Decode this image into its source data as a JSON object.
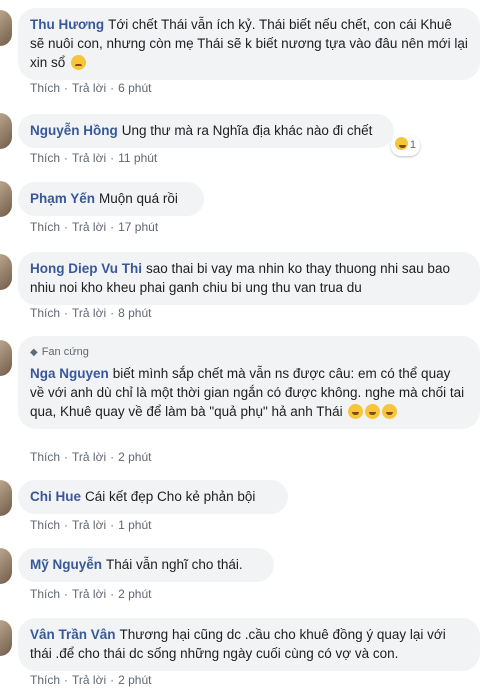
{
  "labels": {
    "like": "Thích",
    "reply": "Trả lời",
    "dot": "·"
  },
  "comments": [
    {
      "name": "Thu Hương",
      "text": "Tới chết Thái vẫn ích kỷ. Thái biết nếu chết, con cái Khuê sẽ nuôi con, nhưng còn mẹ Thái sẽ k biết nương tựa vào đâu nên mới lại xin sổ",
      "emoji": "sad-face",
      "time": "6 phút"
    },
    {
      "name": "Nguyễn Hồng",
      "text": "Ung thư mà ra Nghĩa địa khác nào đi chết",
      "reaction": {
        "icon": "laughing-face",
        "count": "1"
      },
      "time": "11 phút"
    },
    {
      "name": "Phạm Yến",
      "text": "Muộn quá rồi",
      "time": "17 phút"
    },
    {
      "name": "Hong Diep Vu Thi",
      "text": "sao thai bi vay ma nhin ko thay thuong nhi sau bao nhiu noi kho kheu phai ganh chiu bi ung thu van trua du",
      "time": "8 phút"
    },
    {
      "badge": "Fan cứng",
      "badge_icon": "diamond-icon",
      "name": "Nga Nguyen",
      "text": "biết mình sắp chết mà vẫn ns được câu: em có thể quay về với anh dù chỉ là một thời gian ngắn có được không. nghe mà chối tai qua, Khuê quay về để làm bà \"quả phụ\" hả anh Thái",
      "emoji": "laughing-face x3",
      "time": "2 phút"
    },
    {
      "name": "Chi Hue",
      "text": "Cái kết đẹp Cho kẻ phản bội",
      "time": "1 phút"
    },
    {
      "name": "Mỹ Nguyễn",
      "text": "Thái vẫn nghĩ cho thái.",
      "time": "2 phút"
    },
    {
      "name": "Vân Trần Vân",
      "text": "Thương hại cũng dc .cầu cho khuê đồng ý quay lại với thái .để cho thái dc sống những ngày cuối cùng có vợ và con.",
      "time": "2 phút"
    }
  ]
}
